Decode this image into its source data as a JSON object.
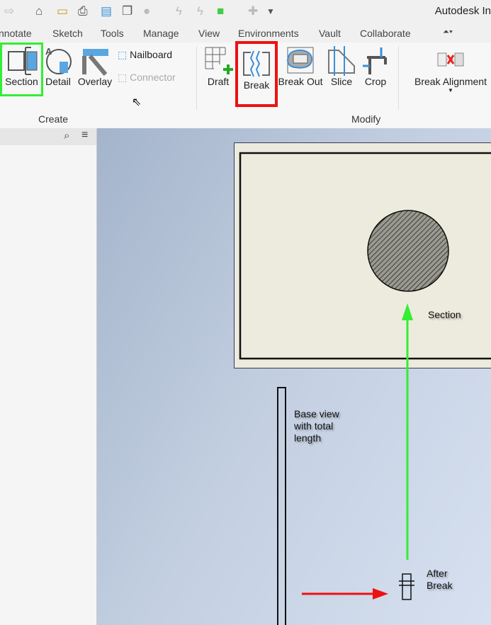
{
  "app": {
    "title": "Autodesk In"
  },
  "tabs": [
    "nnotate",
    "Sketch",
    "Tools",
    "Manage",
    "View",
    "Environments",
    "Vault",
    "Collaborate"
  ],
  "ribbon": {
    "create": {
      "label": "Create",
      "section": "Section",
      "detail": "Detail",
      "overlay": "Overlay",
      "nailboard": "Nailboard",
      "connector": "Connector"
    },
    "draft": "Draft",
    "modify": {
      "label": "Modify",
      "break": "Break",
      "break_out": "Break Out",
      "slice": "Slice",
      "crop": "Crop",
      "break_alignment": "Break Alignment"
    }
  },
  "drawing": {
    "section_label": "Section",
    "base_view_label": [
      "Base view",
      "with total",
      "length"
    ],
    "after_break_label": [
      "After",
      "Break"
    ]
  },
  "colors": {
    "highlight_green": "#33ee33",
    "highlight_red": "#ee1111",
    "accent_blue": "#3a8fd8"
  }
}
